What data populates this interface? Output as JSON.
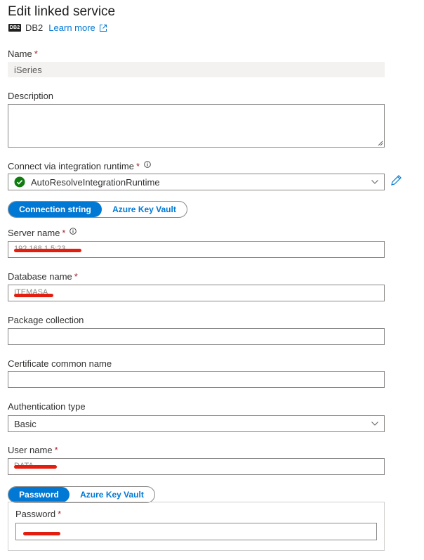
{
  "header": {
    "title": "Edit linked service",
    "db_icon_text": "DB2",
    "service_type": "DB2",
    "learn_more": "Learn more"
  },
  "fields": {
    "name": {
      "label": "Name",
      "required": "*",
      "value": "iSeries"
    },
    "description": {
      "label": "Description",
      "value": ""
    },
    "runtime": {
      "label": "Connect via integration runtime",
      "required": "*",
      "value": "AutoResolveIntegrationRuntime"
    },
    "connection_toggle": {
      "options": [
        "Connection string",
        "Azure Key Vault"
      ],
      "selected": "Connection string"
    },
    "server_name": {
      "label": "Server name",
      "required": "*",
      "value": "192.168.1.5:23"
    },
    "database_name": {
      "label": "Database name",
      "required": "*",
      "value": "ITEMASA"
    },
    "package_collection": {
      "label": "Package collection",
      "value": ""
    },
    "certificate_common_name": {
      "label": "Certificate common name",
      "value": ""
    },
    "authentication_type": {
      "label": "Authentication type",
      "value": "Basic"
    },
    "user_name": {
      "label": "User name",
      "required": "*",
      "value": "DATA"
    },
    "password_toggle": {
      "options": [
        "Password",
        "Azure Key Vault"
      ],
      "selected": "Password"
    },
    "password": {
      "label": "Password",
      "required": "*",
      "value": ""
    }
  },
  "colors": {
    "accent": "#0078d4",
    "required": "#a4262c",
    "success": "#107c10",
    "redaction": "#e31e10"
  },
  "icons": [
    "db2-icon",
    "external-link-icon",
    "info-icon",
    "check-circle-icon",
    "chevron-down-icon",
    "edit-pencil-icon"
  ]
}
